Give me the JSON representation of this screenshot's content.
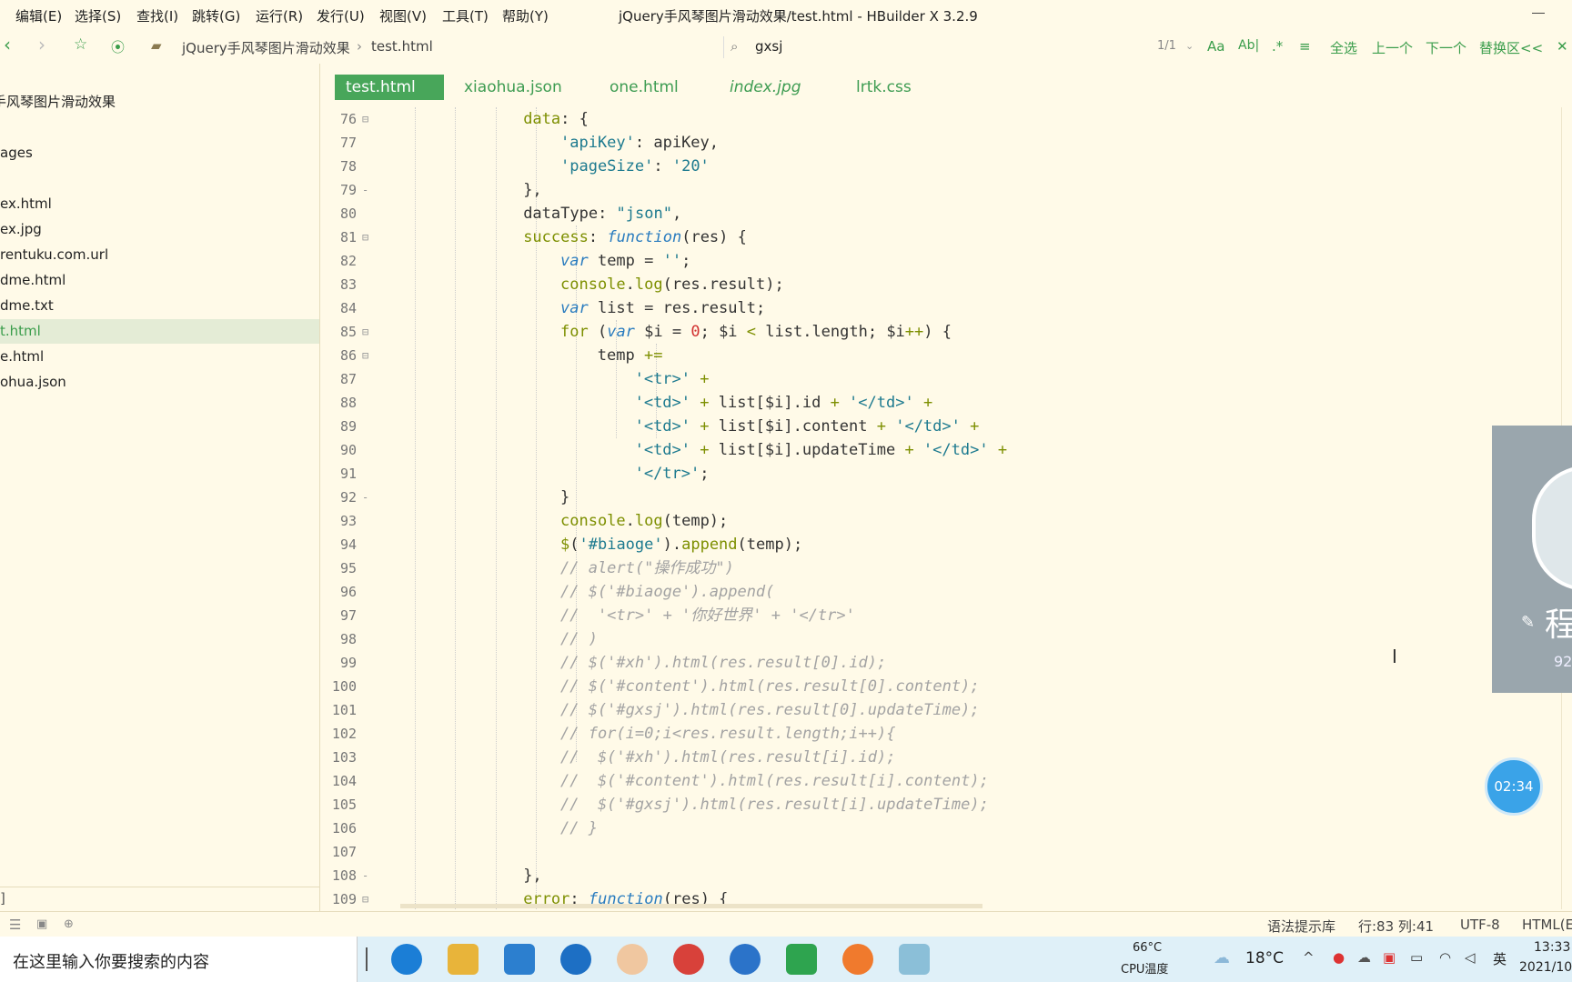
{
  "menubar": {
    "items": [
      "编辑(E)",
      "选择(S)",
      "查找(I)",
      "跳转(G)",
      "运行(R)",
      "发行(U)",
      "视图(V)",
      "工具(T)",
      "帮助(Y)"
    ],
    "title": "jQuery手风琴图片滑动效果/test.html - HBuilder X 3.2.9"
  },
  "toolbar": {
    "breadcrumb_project": "jQuery手风琴图片滑动效果",
    "breadcrumb_sep": "›",
    "breadcrumb_file": "test.html",
    "search_value": "gxsj",
    "match_count": "1/1",
    "opt_case": "Aa",
    "opt_word": "Ab|",
    "opt_regex": ".*",
    "select_all": "全选",
    "prev": "上一个",
    "next": "下一个",
    "replace": "替换区<<",
    "close": "✕"
  },
  "sidebar": {
    "items": [
      {
        "label": "手风琴图片滑动效果",
        "selected": false
      },
      {
        "label": "ages",
        "selected": false
      },
      {
        "label": "ex.html",
        "selected": false
      },
      {
        "label": "ex.jpg",
        "selected": false
      },
      {
        "label": "rentuku.com.url",
        "selected": false
      },
      {
        "label": "dme.html",
        "selected": false
      },
      {
        "label": "dme.txt",
        "selected": false
      },
      {
        "label": "t.html",
        "selected": true
      },
      {
        "label": "e.html",
        "selected": false
      },
      {
        "label": "ohua.json",
        "selected": false
      }
    ],
    "bottom_label": "]"
  },
  "tabs": [
    {
      "label": "test.html",
      "active": true
    },
    {
      "label": "xiaohua.json",
      "active": false
    },
    {
      "label": "one.html",
      "active": false
    },
    {
      "label": "index.jpg",
      "active": false
    },
    {
      "label": "lrtk.css",
      "active": false
    }
  ],
  "editor": {
    "lines": [
      {
        "num": "76",
        "fold": "⊟",
        "indent": 4,
        "tokens": [
          [
            "key",
            "data"
          ],
          [
            "blk",
            ": {"
          ]
        ]
      },
      {
        "num": "77",
        "fold": "",
        "indent": 5,
        "tokens": [
          [
            "str",
            "'apiKey'"
          ],
          [
            "blk",
            ": apiKey,"
          ]
        ]
      },
      {
        "num": "78",
        "fold": "",
        "indent": 5,
        "tokens": [
          [
            "str",
            "'pageSize'"
          ],
          [
            "blk",
            ": "
          ],
          [
            "str",
            "'20'"
          ]
        ]
      },
      {
        "num": "79",
        "fold": "-",
        "indent": 4,
        "tokens": [
          [
            "blk",
            "},"
          ]
        ]
      },
      {
        "num": "80",
        "fold": "",
        "indent": 4,
        "tokens": [
          [
            "blk",
            "dataType: "
          ],
          [
            "str",
            "\"json\""
          ],
          [
            "blk",
            ","
          ]
        ]
      },
      {
        "num": "81",
        "fold": "⊟",
        "indent": 4,
        "tokens": [
          [
            "key",
            "success"
          ],
          [
            "blk",
            ": "
          ],
          [
            "kw",
            "function"
          ],
          [
            "blk",
            "(res) {"
          ]
        ]
      },
      {
        "num": "82",
        "fold": "",
        "indent": 5,
        "tokens": [
          [
            "kw",
            "var"
          ],
          [
            "blk",
            " temp = "
          ],
          [
            "str",
            "''"
          ],
          [
            "blk",
            ";"
          ]
        ]
      },
      {
        "num": "83",
        "fold": "",
        "indent": 5,
        "tokens": [
          [
            "fn",
            "console"
          ],
          [
            "blk",
            "."
          ],
          [
            "fn",
            "log"
          ],
          [
            "blk",
            "(res.result);"
          ]
        ]
      },
      {
        "num": "84",
        "fold": "",
        "indent": 5,
        "tokens": [
          [
            "kw",
            "var"
          ],
          [
            "blk",
            " list = res.result;"
          ]
        ]
      },
      {
        "num": "85",
        "fold": "⊟",
        "indent": 5,
        "tokens": [
          [
            "key",
            "for"
          ],
          [
            "blk",
            " ("
          ],
          [
            "kw",
            "var"
          ],
          [
            "blk",
            " $i = "
          ],
          [
            "num",
            "0"
          ],
          [
            "blk",
            "; $i "
          ],
          [
            "op",
            "<"
          ],
          [
            "blk",
            " list.length; $i"
          ],
          [
            "op",
            "++"
          ],
          [
            "blk",
            ") {"
          ]
        ]
      },
      {
        "num": "86",
        "fold": "⊟",
        "indent": 6,
        "tokens": [
          [
            "blk",
            "temp "
          ],
          [
            "op",
            "+="
          ]
        ]
      },
      {
        "num": "87",
        "fold": "",
        "indent": 7,
        "tokens": [
          [
            "str",
            "'<tr>'"
          ],
          [
            "op",
            " +"
          ]
        ]
      },
      {
        "num": "88",
        "fold": "",
        "indent": 7,
        "tokens": [
          [
            "str",
            "'<td>'"
          ],
          [
            "op",
            " +"
          ],
          [
            "blk",
            " list[$i].id "
          ],
          [
            "op",
            "+"
          ],
          [
            "str",
            " '</td>'"
          ],
          [
            "op",
            " +"
          ]
        ]
      },
      {
        "num": "89",
        "fold": "",
        "indent": 7,
        "tokens": [
          [
            "str",
            "'<td>'"
          ],
          [
            "op",
            " +"
          ],
          [
            "blk",
            " list[$i].content "
          ],
          [
            "op",
            "+"
          ],
          [
            "str",
            " '</td>'"
          ],
          [
            "op",
            " +"
          ]
        ]
      },
      {
        "num": "90",
        "fold": "",
        "indent": 7,
        "tokens": [
          [
            "str",
            "'<td>'"
          ],
          [
            "op",
            " +"
          ],
          [
            "blk",
            " list[$i].updateTime "
          ],
          [
            "op",
            "+"
          ],
          [
            "str",
            " '</td>'"
          ],
          [
            "op",
            " +"
          ]
        ]
      },
      {
        "num": "91",
        "fold": "",
        "indent": 7,
        "tokens": [
          [
            "str",
            "'</tr>'"
          ],
          [
            "blk",
            ";"
          ]
        ]
      },
      {
        "num": "92",
        "fold": "-",
        "indent": 5,
        "tokens": [
          [
            "blk",
            "}"
          ]
        ]
      },
      {
        "num": "93",
        "fold": "",
        "indent": 5,
        "tokens": [
          [
            "fn",
            "console"
          ],
          [
            "blk",
            "."
          ],
          [
            "fn",
            "log"
          ],
          [
            "blk",
            "(temp);"
          ]
        ]
      },
      {
        "num": "94",
        "fold": "",
        "indent": 5,
        "tokens": [
          [
            "fn",
            "$"
          ],
          [
            "blk",
            "("
          ],
          [
            "str",
            "'#biaoge'"
          ],
          [
            "blk",
            ")."
          ],
          [
            "fn",
            "append"
          ],
          [
            "blk",
            "(temp);"
          ]
        ]
      },
      {
        "num": "95",
        "fold": "",
        "indent": 5,
        "tokens": [
          [
            "com",
            "// alert(\"操作成功\")"
          ]
        ]
      },
      {
        "num": "96",
        "fold": "",
        "indent": 5,
        "tokens": [
          [
            "com",
            "// $('#biaoge').append("
          ]
        ]
      },
      {
        "num": "97",
        "fold": "",
        "indent": 5,
        "tokens": [
          [
            "com",
            "//  '<tr>' + '你好世界' + '</tr>'"
          ]
        ]
      },
      {
        "num": "98",
        "fold": "",
        "indent": 5,
        "tokens": [
          [
            "com",
            "// )"
          ]
        ]
      },
      {
        "num": "99",
        "fold": "",
        "indent": 5,
        "tokens": [
          [
            "com",
            "// $('#xh').html(res.result[0].id);"
          ]
        ]
      },
      {
        "num": "100",
        "fold": "",
        "indent": 5,
        "tokens": [
          [
            "com",
            "// $('#content').html(res.result[0].content);"
          ]
        ]
      },
      {
        "num": "101",
        "fold": "",
        "indent": 5,
        "tokens": [
          [
            "com",
            "// $('#gxsj').html(res.result[0].updateTime);"
          ]
        ]
      },
      {
        "num": "102",
        "fold": "",
        "indent": 5,
        "tokens": [
          [
            "com",
            "// for(i=0;i<res.result.length;i++){"
          ]
        ]
      },
      {
        "num": "103",
        "fold": "",
        "indent": 5,
        "tokens": [
          [
            "com",
            "//  $('#xh').html(res.result[i].id);"
          ]
        ]
      },
      {
        "num": "104",
        "fold": "",
        "indent": 5,
        "tokens": [
          [
            "com",
            "//  $('#content').html(res.result[i].content);"
          ]
        ]
      },
      {
        "num": "105",
        "fold": "",
        "indent": 5,
        "tokens": [
          [
            "com",
            "//  $('#gxsj').html(res.result[i].updateTime);"
          ]
        ]
      },
      {
        "num": "106",
        "fold": "",
        "indent": 5,
        "tokens": [
          [
            "com",
            "// }"
          ]
        ]
      },
      {
        "num": "107",
        "fold": "",
        "indent": 5,
        "tokens": []
      },
      {
        "num": "108",
        "fold": "-",
        "indent": 4,
        "tokens": [
          [
            "blk",
            "},"
          ]
        ]
      },
      {
        "num": "109",
        "fold": "⊟",
        "indent": 4,
        "tokens": [
          [
            "key",
            "error"
          ],
          [
            "blk",
            ": "
          ],
          [
            "kw",
            "function"
          ],
          [
            "blk",
            "(res) {"
          ]
        ]
      }
    ]
  },
  "statusbar": {
    "hint_lib": "语法提示库",
    "position": "行:83  列:41",
    "encoding": "UTF-8",
    "lang": "HTML(E"
  },
  "overlay": {
    "name_char": "程",
    "count": "92",
    "timer": "02:34"
  },
  "taskbar": {
    "search_placeholder": "在这里输入你要搜索的内容",
    "cpu_temp": "66°C",
    "cpu_label": "CPU温度",
    "weather": "18°C",
    "ime": "英",
    "time": "13:33",
    "date": "2021/10"
  },
  "colors": {
    "bg": "#fffae8",
    "accent_green": "#48a65a",
    "selected_row": "#e4ecd6"
  }
}
